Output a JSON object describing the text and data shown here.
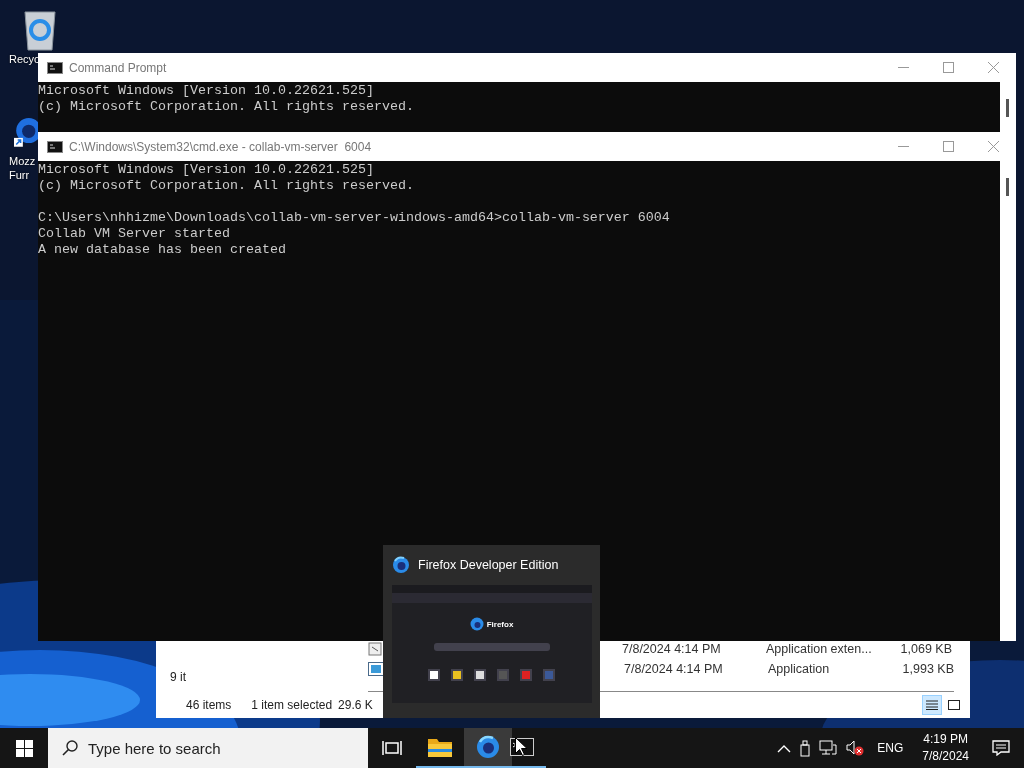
{
  "desktop_icons": [
    {
      "kind": "recycle-bin",
      "lines": [
        "Recyc"
      ]
    },
    {
      "kind": "browser-shortcut",
      "lines": [
        "Mozz",
        "Furr"
      ]
    }
  ],
  "explorer": {
    "left_text": "9 it",
    "rows": [
      {
        "kind": "extension",
        "date": "7/8/2024 4:14 PM",
        "type": "Application exten...",
        "size": "1,069 KB"
      },
      {
        "kind": "application",
        "date": "7/8/2024 4:14 PM",
        "type": "Application",
        "size": "1,993 KB"
      }
    ],
    "item_count": "46 items",
    "selection": "1 item selected",
    "selection_size": "29.6 K",
    "views": [
      {
        "kind": "details",
        "selected": true
      },
      {
        "kind": "tiles",
        "selected": false
      }
    ]
  },
  "windows": [
    {
      "title": "Command Prompt",
      "blocks": [
        [
          "Microsoft Windows [Version 10.0.22621.525]",
          "(c) Microsoft Corporation. All rights reserved."
        ]
      ]
    },
    {
      "title": "C:\\Windows\\System32\\cmd.exe - collab-vm-server  6004",
      "blocks": [
        [
          "Microsoft Windows [Version 10.0.22621.525]",
          "(c) Microsoft Corporation. All rights reserved."
        ],
        [
          "C:\\Users\\nhhizme\\Downloads\\collab-vm-server-windows-amd64>collab-vm-server 6004",
          "Collab VM Server started",
          "A new database has been created"
        ]
      ]
    }
  ],
  "thumbnail": {
    "title": "Firefox Developer Edition",
    "preview_label": "Firefox"
  },
  "taskbar": {
    "search_placeholder": "Type here to search",
    "apps": [
      {
        "kind": "task-view",
        "running": false,
        "selected": false
      },
      {
        "kind": "file-explorer",
        "running": true,
        "selected": false
      },
      {
        "kind": "browser",
        "running": true,
        "selected": true
      },
      {
        "kind": "console",
        "running": true,
        "selected": false
      }
    ],
    "language": "ENG",
    "time": "4:19 PM",
    "date": "7/8/2024"
  }
}
